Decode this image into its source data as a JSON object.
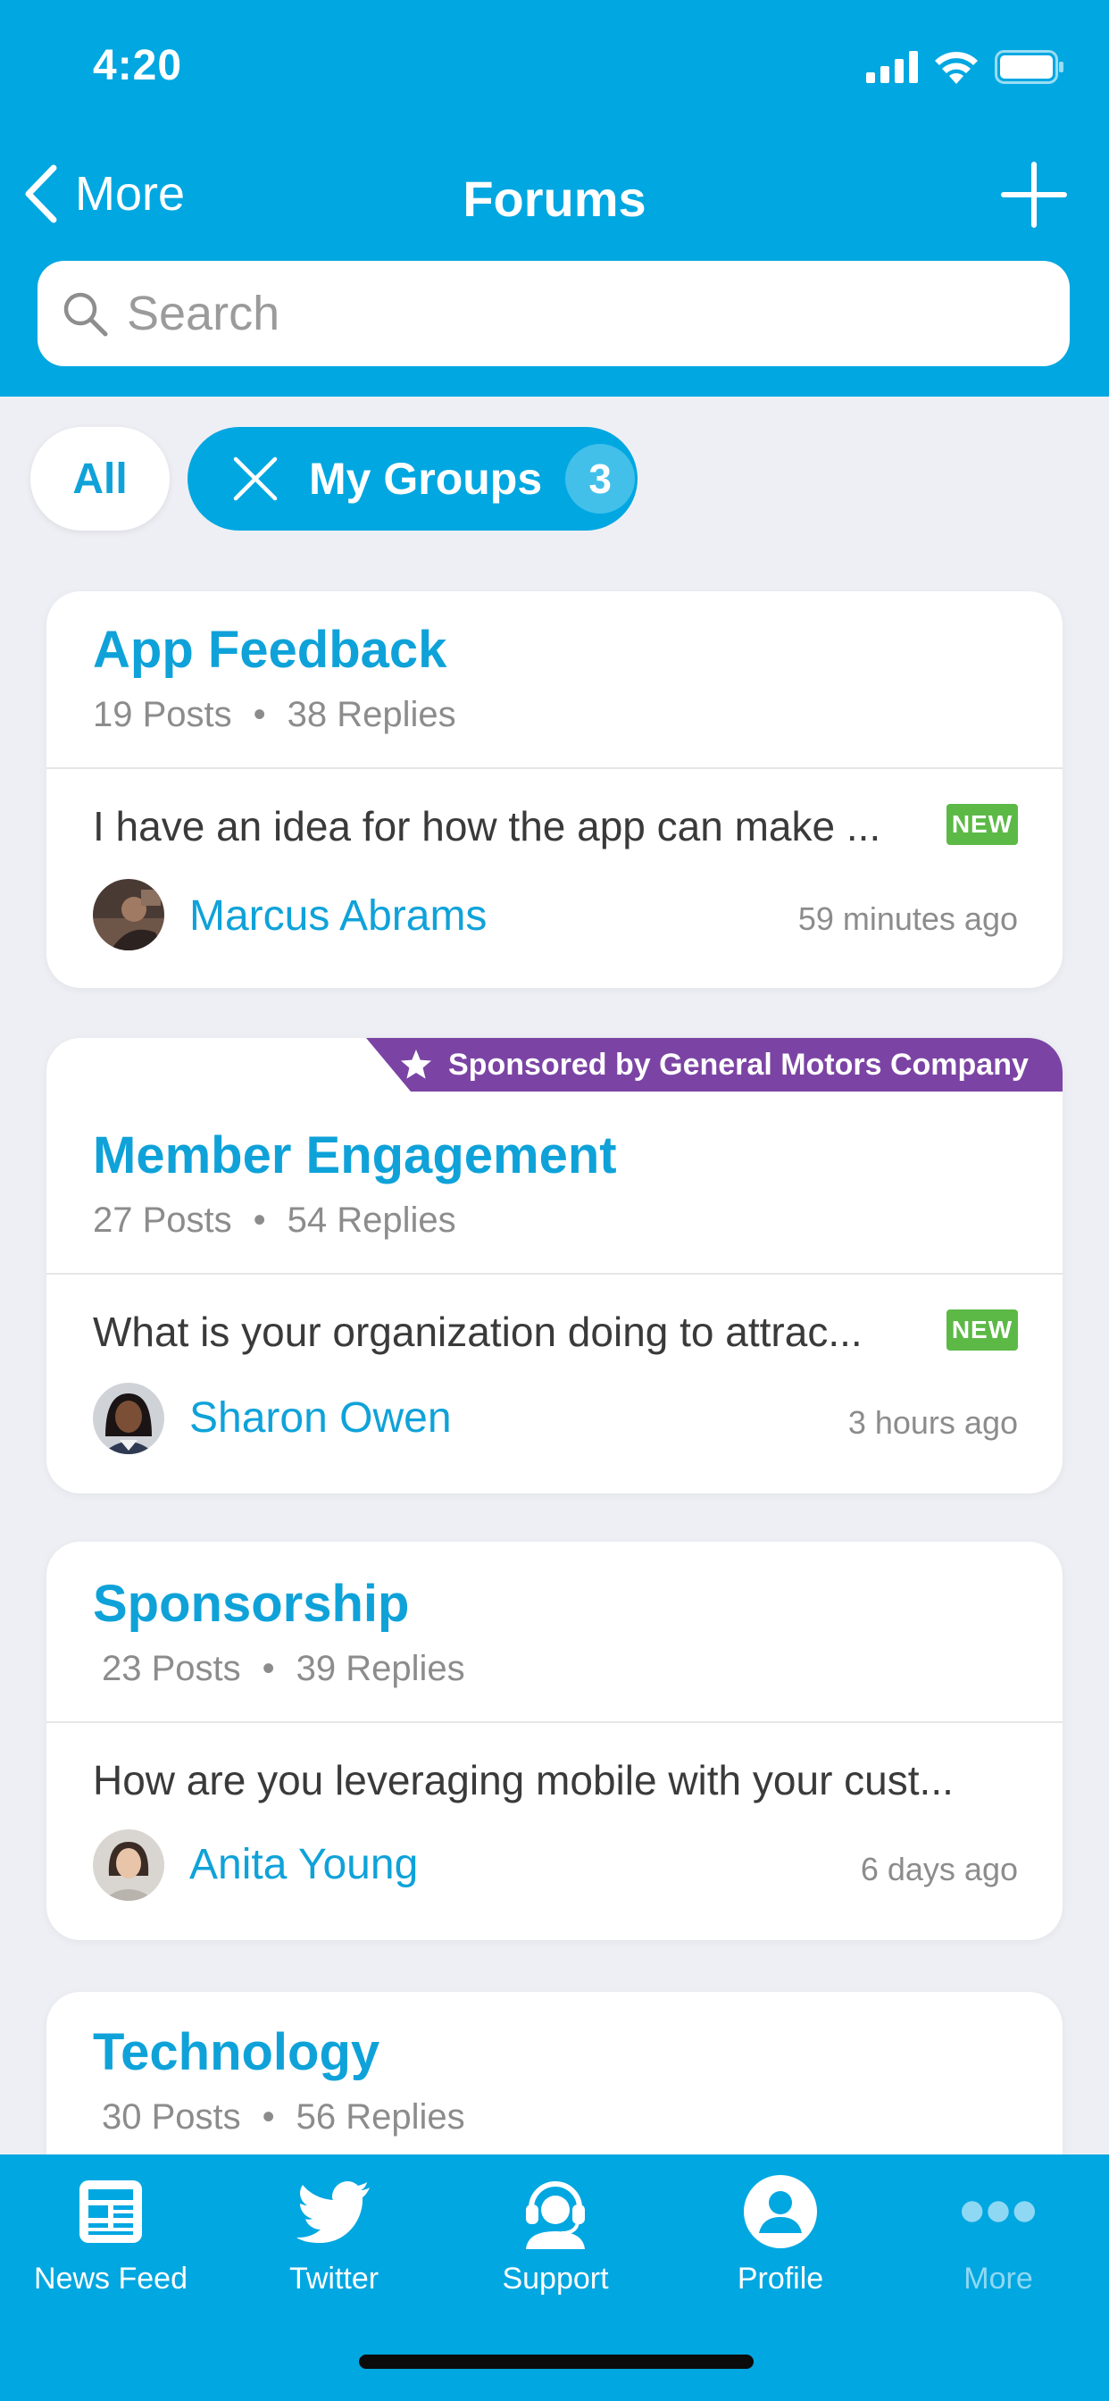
{
  "status_bar": {
    "time": "4:20"
  },
  "nav": {
    "back_label": "More",
    "title": "Forums",
    "add_icon": "plus-icon"
  },
  "search": {
    "placeholder": "Search",
    "value": ""
  },
  "filters": {
    "all_label": "All",
    "groups_label": "My Groups",
    "groups_count": "3"
  },
  "forums": [
    {
      "title": "App Feedback",
      "posts": "19 Posts",
      "replies": "38 Replies",
      "latest_post": "I have an idea for how the app can make ...",
      "badge": "NEW",
      "author": "Marcus Abrams",
      "time": "59 minutes ago"
    },
    {
      "sponsor": "Sponsored by General Motors Company",
      "title": "Member Engagement",
      "posts": "27 Posts",
      "replies": "54 Replies",
      "latest_post": "What is your organization doing to attrac...",
      "badge": "NEW",
      "author": "Sharon Owen",
      "time": "3 hours ago"
    },
    {
      "title": "Sponsorship",
      "posts": "23 Posts",
      "replies": "39 Replies",
      "latest_post": "How are you leveraging mobile with your cust...",
      "author": "Anita Young",
      "time": "6 days ago"
    },
    {
      "title": "Technology",
      "posts": "30 Posts",
      "replies": "56 Replies"
    }
  ],
  "tabs": [
    {
      "label": "News Feed",
      "icon": "newspaper-icon"
    },
    {
      "label": "Twitter",
      "icon": "twitter-bird-icon"
    },
    {
      "label": "Support",
      "icon": "headset-icon"
    },
    {
      "label": "Profile",
      "icon": "person-icon"
    },
    {
      "label": "More",
      "icon": "more-dots-icon"
    }
  ],
  "colors": {
    "brand_blue": "#00a7e1",
    "link_blue": "#0fa2d9",
    "new_badge_green": "#5cb946",
    "sponsor_purple": "#7b44a4",
    "background": "#eeeff4"
  }
}
